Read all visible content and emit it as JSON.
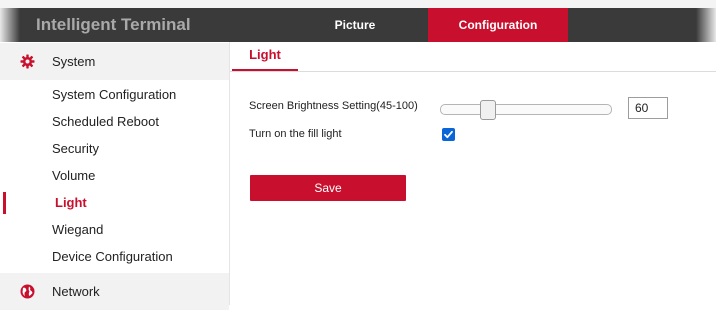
{
  "header": {
    "app_title": "Intelligent Terminal",
    "tabs": [
      {
        "label": "Picture"
      },
      {
        "label": "Configuration",
        "active": true
      }
    ]
  },
  "sidebar": {
    "groups": [
      {
        "label": "System",
        "icon": "gear-icon",
        "icon_color": "#c8102e"
      },
      {
        "label": "Network",
        "icon": "globe-icon",
        "icon_color": "#c8102e"
      }
    ],
    "items": [
      {
        "label": "System Configuration"
      },
      {
        "label": "Scheduled Reboot"
      },
      {
        "label": "Security"
      },
      {
        "label": "Volume"
      },
      {
        "label": "Light",
        "active": true
      },
      {
        "label": "Wiegand"
      },
      {
        "label": "Device Configuration"
      }
    ]
  },
  "main": {
    "tab_label": "Light",
    "brightness": {
      "label": "Screen Brightness Setting(45-100)",
      "min": 45,
      "max": 100,
      "value": "60"
    },
    "fill_light": {
      "label": "Turn on the fill light",
      "checked": true
    },
    "save_label": "Save"
  },
  "colors": {
    "accent": "#c8102e",
    "header_bg": "#3a3a3a",
    "checkbox": "#0a66d8"
  }
}
